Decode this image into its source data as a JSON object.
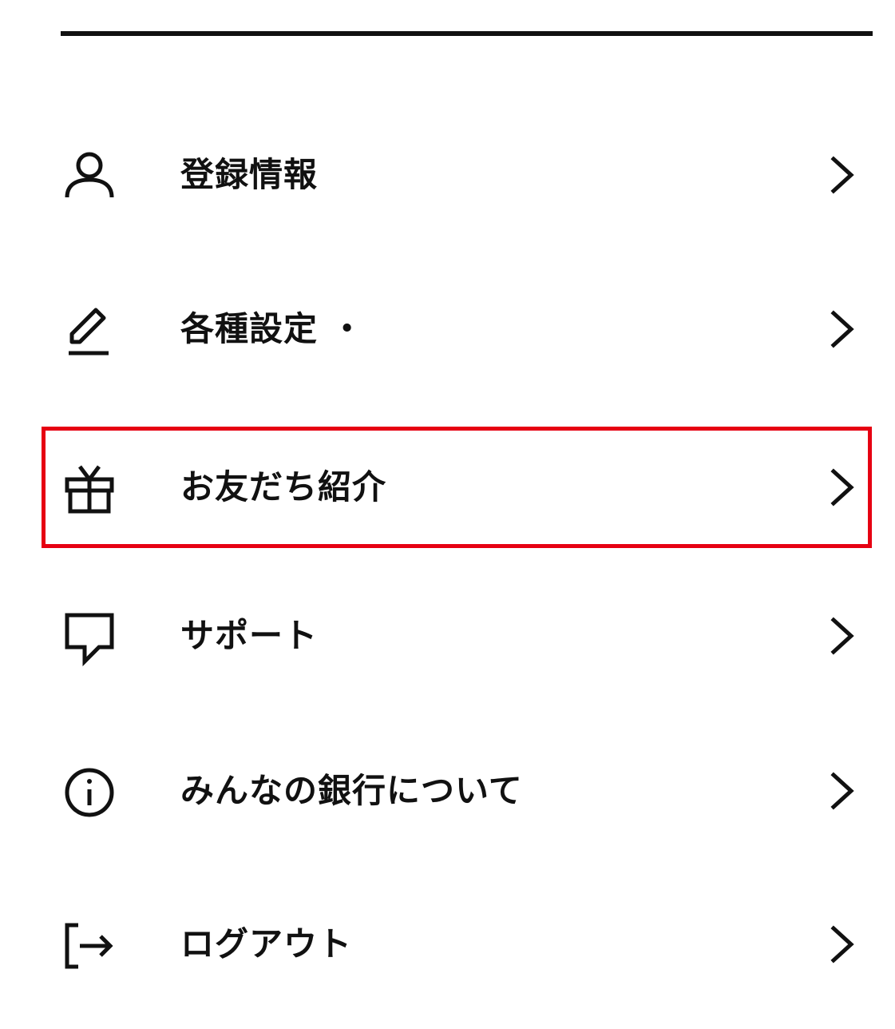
{
  "menu": {
    "items": [
      {
        "label": "登録情報",
        "icon": "person-icon"
      },
      {
        "label": "各種設定 ・",
        "icon": "pencil-icon"
      },
      {
        "label": "お友だち紹介",
        "icon": "gift-icon",
        "highlighted": true
      },
      {
        "label": "サポート",
        "icon": "chat-bubble-icon"
      },
      {
        "label": "みんなの銀行について",
        "icon": "info-icon"
      },
      {
        "label": "ログアウト",
        "icon": "logout-icon"
      }
    ],
    "highlight_color": "#e60012",
    "text_color": "#111111"
  }
}
